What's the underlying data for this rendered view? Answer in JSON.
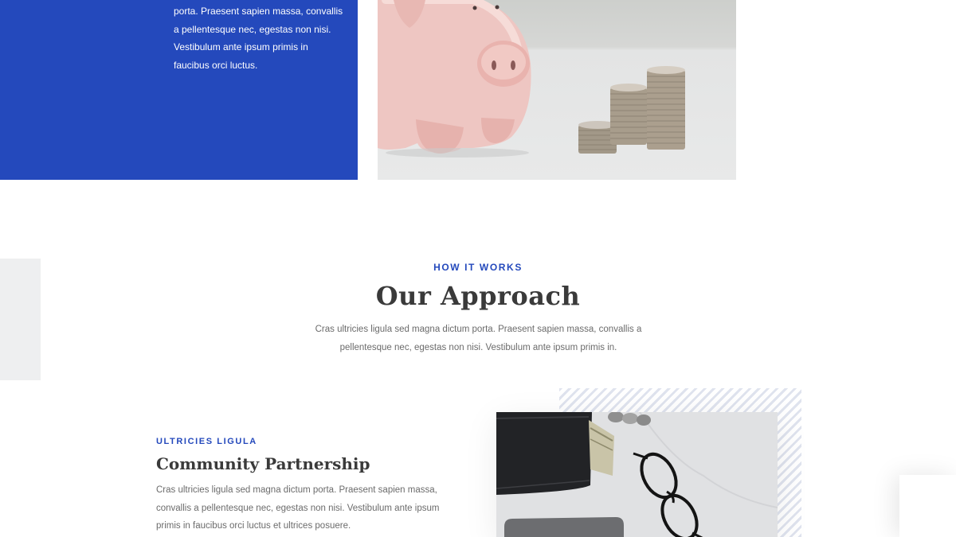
{
  "top": {
    "blue_text": "porta. Praesent sapien massa, convallis a pellentesque nec, egestas non nisi. Vestibulum ante ipsum primis in faucibus orci luctus."
  },
  "approach": {
    "eyebrow": "HOW IT WORKS",
    "title": "Our Approach",
    "description": "Cras ultricies ligula sed magna dictum porta. Praesent sapien massa, convallis a pellentesque nec, egestas non nisi. Vestibulum ante ipsum primis in."
  },
  "feature": {
    "eyebrow": "ULTRICIES LIGULA",
    "title": "Community Partnership",
    "description": "Cras ultricies ligula sed magna dictum porta. Praesent sapien massa, convallis a pellentesque nec, egestas non nisi. Vestibulum ante ipsum primis in faucibus orci luctus et ultrices posuere."
  },
  "colors": {
    "brand_blue": "#2449bc",
    "heading": "#3a3a3a",
    "body_text": "#6b6b6b"
  }
}
